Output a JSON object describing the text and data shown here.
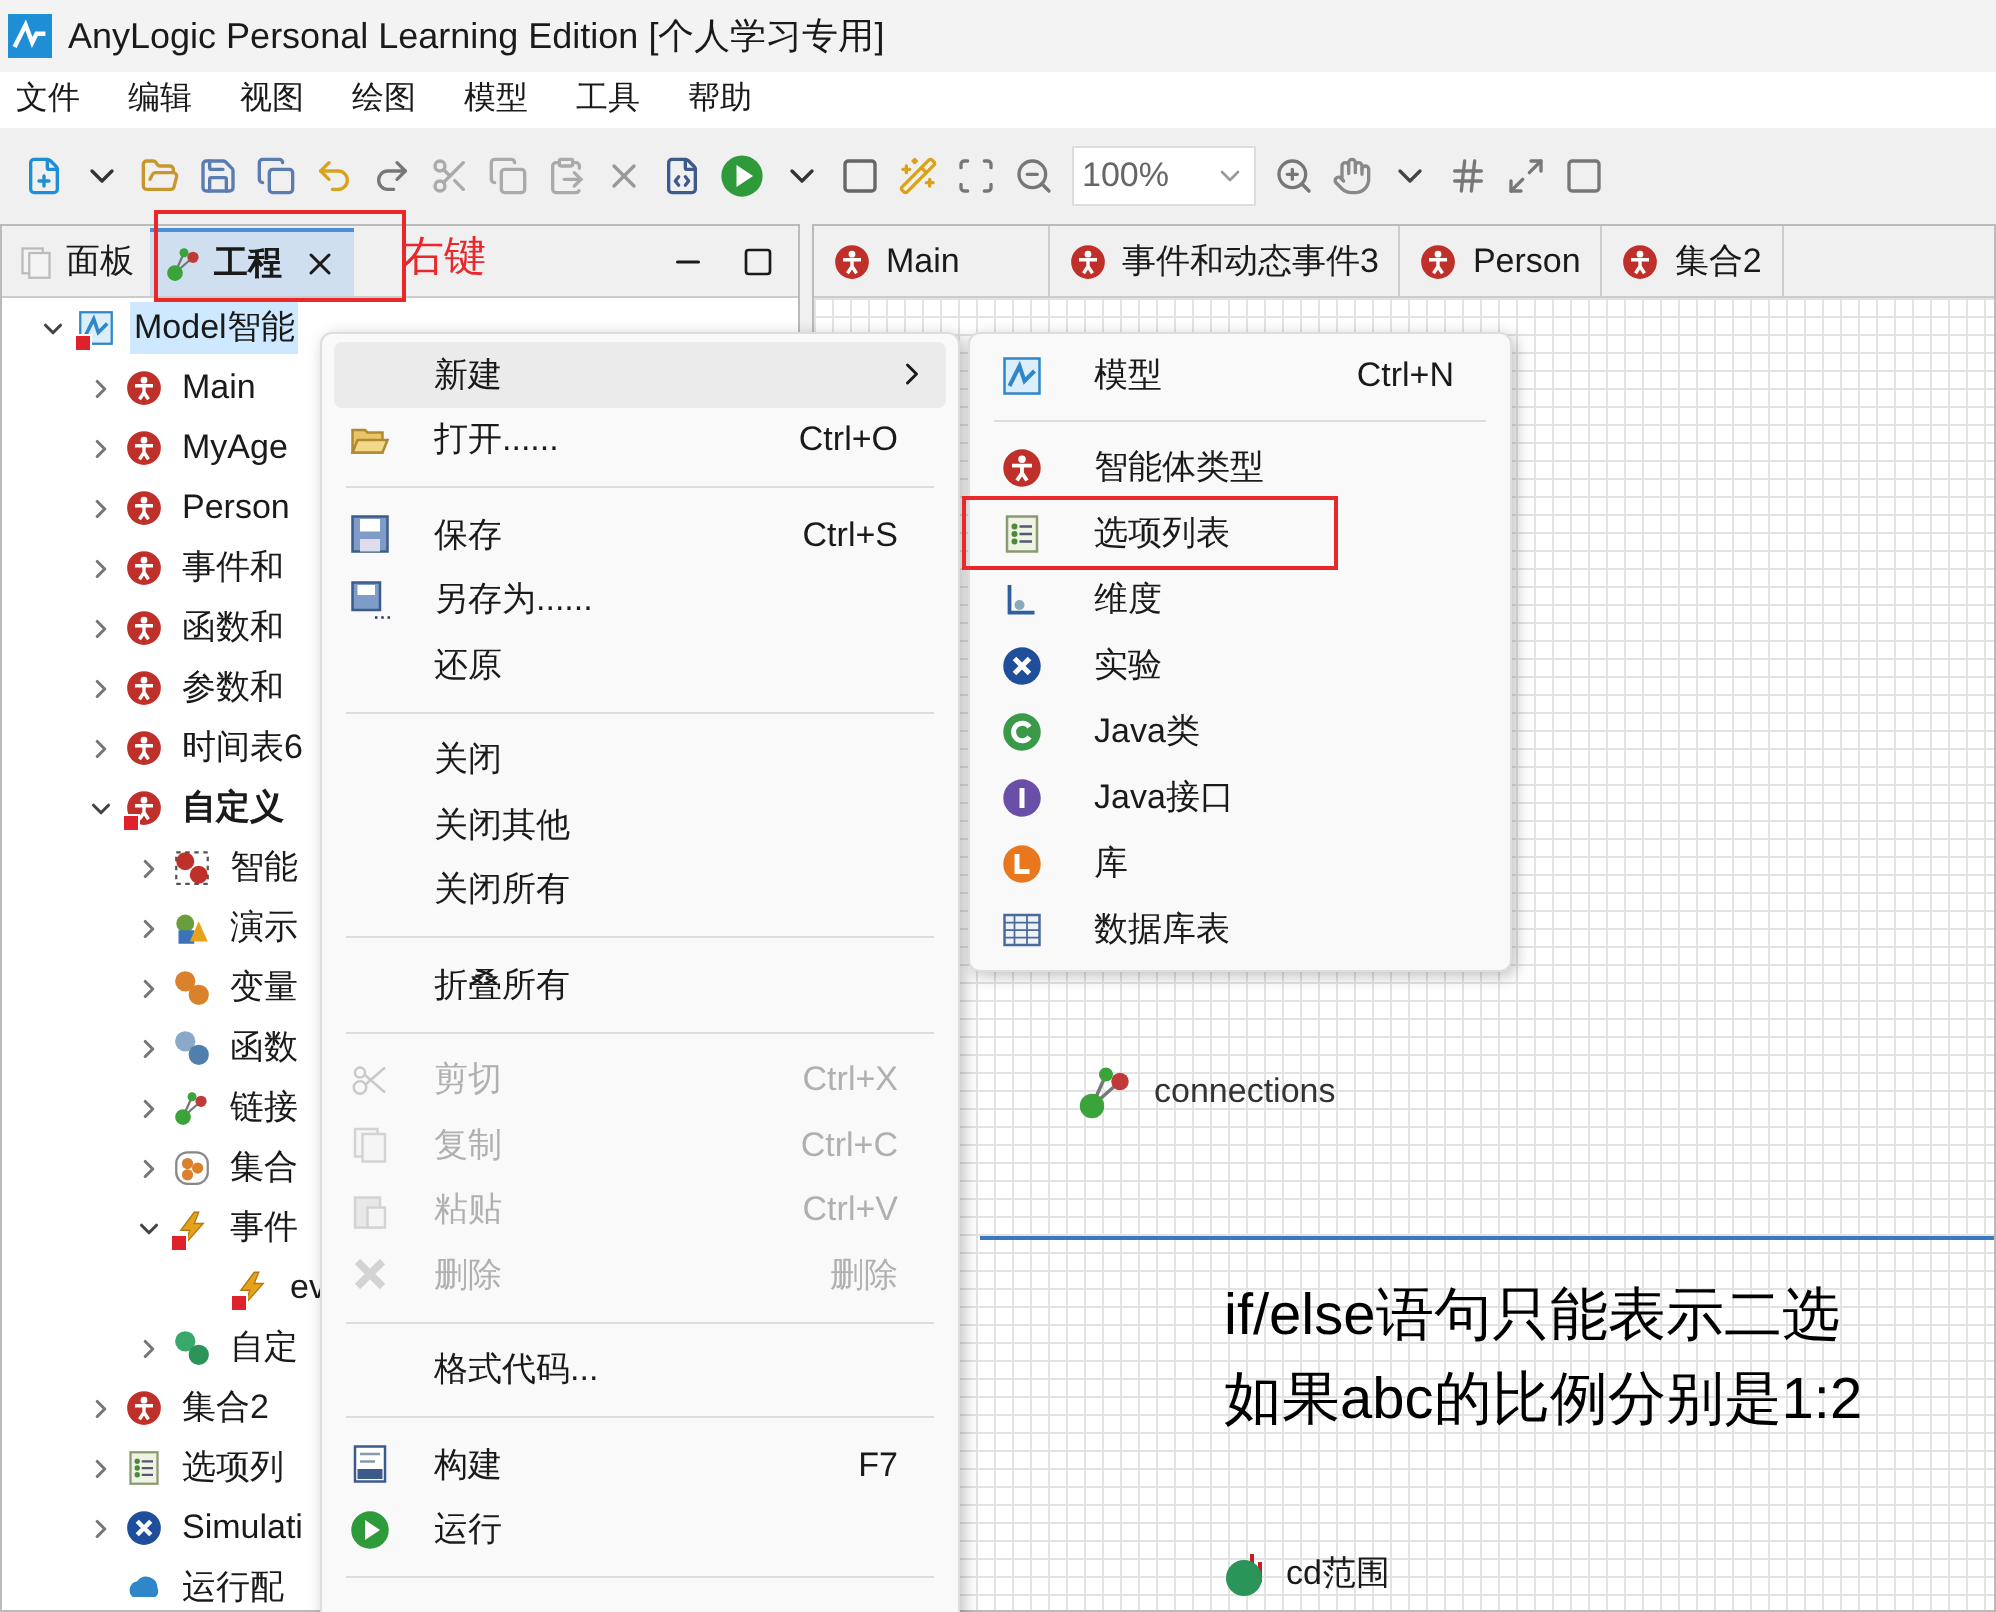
{
  "window": {
    "title": "AnyLogic Personal Learning Edition [个人学习专用]"
  },
  "menu_bar": [
    "文件",
    "编辑",
    "视图",
    "绘图",
    "模型",
    "工具",
    "帮助"
  ],
  "toolbar": {
    "zoom": "100%"
  },
  "left_panel": {
    "tabs": [
      {
        "label": "面板",
        "selected": false
      },
      {
        "label": "工程",
        "selected": true
      }
    ],
    "annotation": "右键",
    "tree": [
      {
        "label": "Model智能",
        "kind": "model",
        "error": true,
        "selected": true,
        "expanded": true,
        "children": [
          {
            "label": "Main",
            "kind": "agent",
            "error": false,
            "selected": false,
            "expanded": false
          },
          {
            "label": "MyAge",
            "kind": "agent",
            "error": false,
            "selected": false,
            "expanded": false
          },
          {
            "label": "Person",
            "kind": "agent",
            "error": false,
            "selected": false,
            "expanded": false
          },
          {
            "label": "事件和",
            "kind": "agent",
            "error": false,
            "selected": false,
            "expanded": false
          },
          {
            "label": "函数和",
            "kind": "agent",
            "error": false,
            "selected": false,
            "expanded": false
          },
          {
            "label": "参数和",
            "kind": "agent",
            "error": false,
            "selected": false,
            "expanded": false
          },
          {
            "label": "时间表6",
            "kind": "agent",
            "error": false,
            "selected": false,
            "expanded": false
          },
          {
            "label": "自定义",
            "kind": "agent",
            "error": true,
            "selected": false,
            "expanded": true,
            "children": [
              {
                "label": "智能",
                "kind": "agents",
                "error": false,
                "selected": false,
                "expanded": false
              },
              {
                "label": "演示",
                "kind": "presentation",
                "error": false,
                "selected": false,
                "expanded": false
              },
              {
                "label": "变量",
                "kind": "variable",
                "error": false,
                "selected": false,
                "expanded": false
              },
              {
                "label": "函数",
                "kind": "function",
                "error": false,
                "selected": false,
                "expanded": false
              },
              {
                "label": "链接",
                "kind": "link",
                "error": false,
                "selected": false,
                "expanded": false
              },
              {
                "label": "集合",
                "kind": "collection",
                "error": false,
                "selected": false,
                "expanded": false
              },
              {
                "label": "事件",
                "kind": "event",
                "error": true,
                "selected": false,
                "expanded": true,
                "children": [
                  {
                    "label": "ev",
                    "kind": "event",
                    "error": true,
                    "selected": false
                  }
                ]
              },
              {
                "label": "自定",
                "kind": "param",
                "error": false,
                "selected": false,
                "expanded": false
              }
            ]
          },
          {
            "label": "集合2",
            "kind": "agent",
            "error": false,
            "selected": false,
            "expanded": false
          },
          {
            "label": "选项列",
            "kind": "options",
            "error": false,
            "selected": false,
            "expanded": false
          },
          {
            "label": "Simulati",
            "kind": "experiment",
            "error": false,
            "selected": false,
            "expanded": false
          },
          {
            "label": "运行配",
            "kind": "run",
            "error": false,
            "selected": false
          }
        ]
      }
    ]
  },
  "editor_tabs": [
    {
      "label": "Main",
      "selected": false
    },
    {
      "label": "事件和动态事件3",
      "selected": false
    },
    {
      "label": "Person",
      "selected": false
    },
    {
      "label": "集合2",
      "selected": false
    }
  ],
  "canvas": {
    "connections": "connections",
    "lines": [
      "if/else语句只能表示二选",
      "如果abc的比例分别是1:2"
    ],
    "parameter": "cd范围"
  },
  "context_menu": {
    "items": [
      {
        "kind": "item",
        "label": "新建",
        "submenu": true,
        "highlighted": true,
        "disabled": false
      },
      {
        "kind": "item",
        "label": "打开......",
        "shortcut": "Ctrl+O",
        "submenu": false,
        "highlighted": false,
        "disabled": false
      },
      {
        "kind": "separator"
      },
      {
        "kind": "item",
        "label": "保存",
        "shortcut": "Ctrl+S",
        "submenu": false,
        "highlighted": false,
        "disabled": false
      },
      {
        "kind": "item",
        "label": "另存为......",
        "submenu": false,
        "highlighted": false,
        "disabled": false
      },
      {
        "kind": "item",
        "label": "还原",
        "submenu": false,
        "highlighted": false,
        "disabled": false
      },
      {
        "kind": "separator"
      },
      {
        "kind": "item",
        "label": "关闭",
        "submenu": false,
        "highlighted": false,
        "disabled": false
      },
      {
        "kind": "item",
        "label": "关闭其他",
        "submenu": false,
        "highlighted": false,
        "disabled": false
      },
      {
        "kind": "item",
        "label": "关闭所有",
        "submenu": false,
        "highlighted": false,
        "disabled": false
      },
      {
        "kind": "separator"
      },
      {
        "kind": "item",
        "label": "折叠所有",
        "submenu": false,
        "highlighted": false,
        "disabled": false
      },
      {
        "kind": "separator"
      },
      {
        "kind": "item",
        "label": "剪切",
        "shortcut": "Ctrl+X",
        "submenu": false,
        "highlighted": false,
        "disabled": true
      },
      {
        "kind": "item",
        "label": "复制",
        "shortcut": "Ctrl+C",
        "submenu": false,
        "highlighted": false,
        "disabled": true
      },
      {
        "kind": "item",
        "label": "粘贴",
        "shortcut": "Ctrl+V",
        "submenu": false,
        "highlighted": false,
        "disabled": true
      },
      {
        "kind": "item",
        "label": "删除",
        "shortcut": "删除",
        "submenu": false,
        "highlighted": false,
        "disabled": true
      },
      {
        "kind": "separator"
      },
      {
        "kind": "item",
        "label": "格式代码...",
        "submenu": false,
        "highlighted": false,
        "disabled": false
      },
      {
        "kind": "separator"
      },
      {
        "kind": "item",
        "label": "构建",
        "shortcut": "F7",
        "submenu": false,
        "highlighted": false,
        "disabled": false
      },
      {
        "kind": "item",
        "label": "运行",
        "submenu": false,
        "highlighted": false,
        "disabled": false
      },
      {
        "kind": "separator"
      }
    ]
  },
  "submenu": {
    "items": [
      {
        "kind": "item",
        "label": "模型",
        "shortcut": "Ctrl+N",
        "marked": false
      },
      {
        "kind": "separator"
      },
      {
        "kind": "item",
        "label": "智能体类型",
        "marked": false
      },
      {
        "kind": "item",
        "label": "选项列表",
        "marked": true
      },
      {
        "kind": "item",
        "label": "维度",
        "marked": false
      },
      {
        "kind": "item",
        "label": "实验",
        "marked": false
      },
      {
        "kind": "item",
        "label": "Java类",
        "marked": false
      },
      {
        "kind": "item",
        "label": "Java接口",
        "marked": false
      },
      {
        "kind": "item",
        "label": "库",
        "marked": false
      },
      {
        "kind": "item",
        "label": "数据库表",
        "marked": false
      }
    ]
  }
}
